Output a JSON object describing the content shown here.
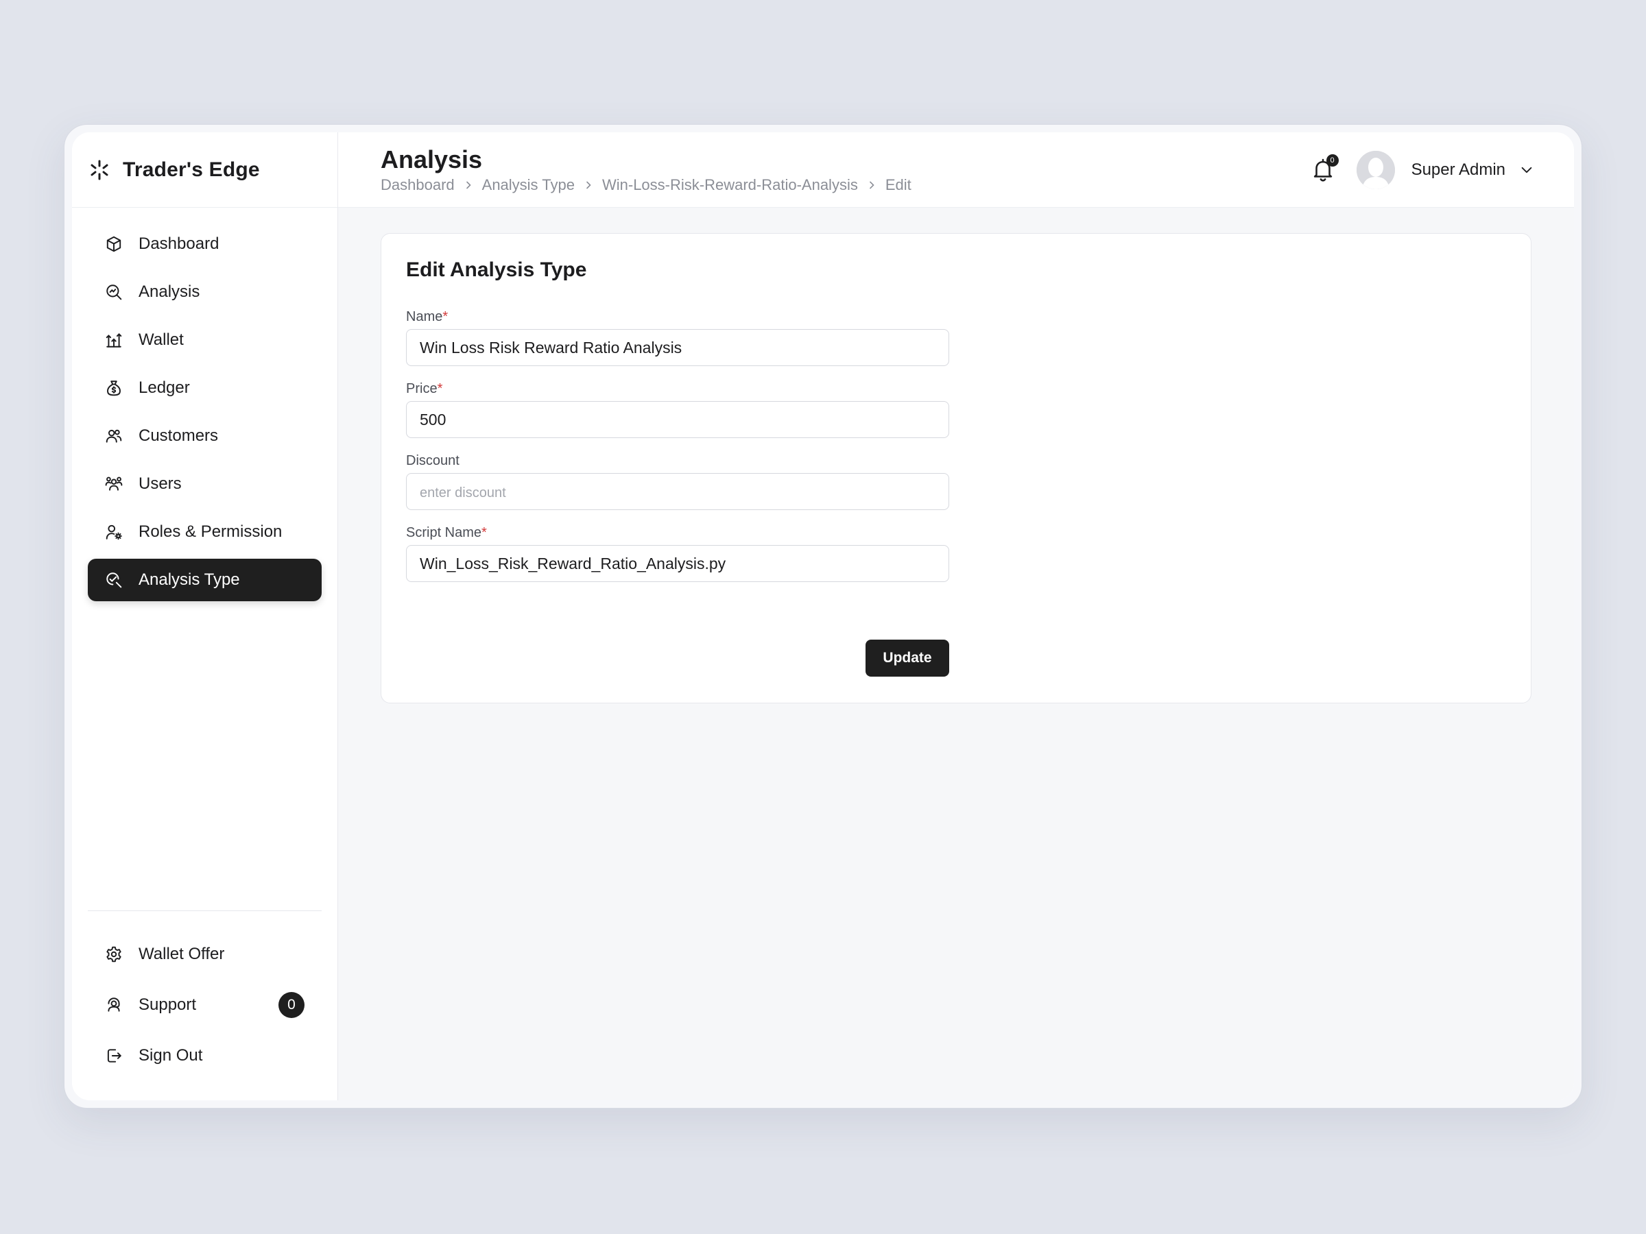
{
  "brand": {
    "name": "Trader's Edge",
    "icon": "sparkle-icon"
  },
  "sidebar": {
    "items": [
      {
        "label": "Dashboard",
        "icon": "cube-icon"
      },
      {
        "label": "Analysis",
        "icon": "search-chart-icon"
      },
      {
        "label": "Wallet",
        "icon": "wallet-arrows-icon"
      },
      {
        "label": "Ledger",
        "icon": "money-bag-icon"
      },
      {
        "label": "Customers",
        "icon": "customers-icon"
      },
      {
        "label": "Users",
        "icon": "users-icon"
      },
      {
        "label": "Roles & Permission",
        "icon": "user-gear-icon"
      },
      {
        "label": "Analysis Type",
        "icon": "analysis-type-icon",
        "active": true
      }
    ],
    "bottom_items": [
      {
        "label": "Wallet Offer",
        "icon": "gear-icon"
      },
      {
        "label": "Support",
        "icon": "support-icon",
        "badge": "0"
      },
      {
        "label": "Sign Out",
        "icon": "sign-out-icon"
      }
    ]
  },
  "header": {
    "title": "Analysis",
    "breadcrumb": [
      "Dashboard",
      "Analysis Type",
      "Win-Loss-Risk-Reward-Ratio-Analysis",
      "Edit"
    ],
    "notifications_count": "0",
    "user_name": "Super Admin"
  },
  "form": {
    "title": "Edit Analysis Type",
    "name": {
      "label": "Name",
      "required_mark": "*",
      "value": "Win Loss Risk Reward Ratio Analysis"
    },
    "price": {
      "label": "Price",
      "required_mark": "*",
      "value": "500"
    },
    "discount": {
      "label": "Discount",
      "value": "",
      "placeholder": "enter discount"
    },
    "script_name": {
      "label": "Script Name",
      "required_mark": "*",
      "value": "Win_Loss_Risk_Reward_Ratio_Analysis.py"
    },
    "submit_label": "Update"
  },
  "colors": {
    "accent": "#1f1f1f",
    "required": "#d23a3a",
    "background": "#e1e4ec"
  }
}
